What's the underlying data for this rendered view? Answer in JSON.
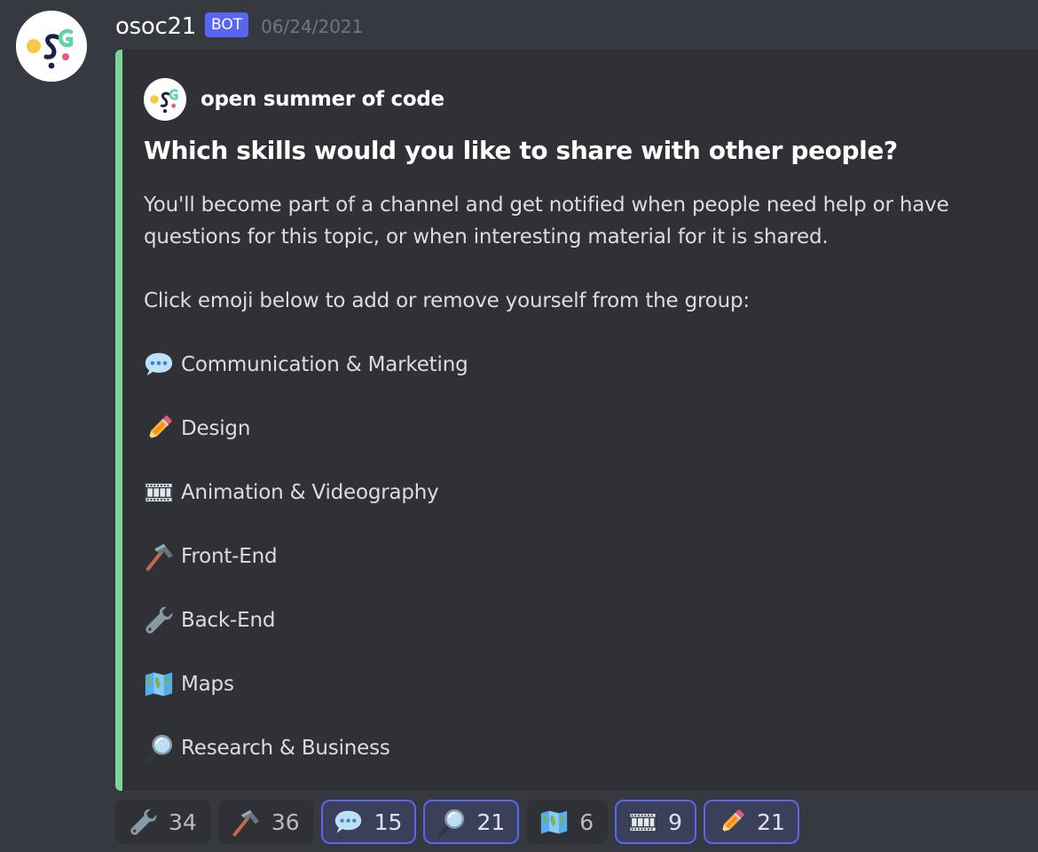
{
  "message": {
    "username": "osoc21",
    "bot_tag": "BOT",
    "timestamp": "06/24/2021",
    "avatar_icon": "osoc-logo-icon"
  },
  "embed": {
    "accent_color": "#7ed39a",
    "author_name": "open summer of code",
    "author_icon": "osoc-logo-icon",
    "title": "Which skills would you like to share with other people?",
    "description": "You'll become part of a channel and get notified when people need help or have questions for this topic, or when interesting material for it is shared.",
    "instruction": "Click emoji below to add or remove yourself from the group:",
    "skills": [
      {
        "icon": "speech-balloon-icon",
        "label": "Communication & Marketing"
      },
      {
        "icon": "pencil-icon",
        "label": "Design"
      },
      {
        "icon": "film-frames-icon",
        "label": "Animation & Videography"
      },
      {
        "icon": "hammer-icon",
        "label": "Front-End"
      },
      {
        "icon": "wrench-icon",
        "label": "Back-End"
      },
      {
        "icon": "world-map-icon",
        "label": "Maps"
      },
      {
        "icon": "magnifying-glass-icon",
        "label": "Research & Business"
      }
    ]
  },
  "reactions": [
    {
      "icon": "wrench-icon",
      "count": "34",
      "active": false
    },
    {
      "icon": "hammer-icon",
      "count": "36",
      "active": false
    },
    {
      "icon": "speech-balloon-icon",
      "count": "15",
      "active": true
    },
    {
      "icon": "magnifying-glass-icon",
      "count": "21",
      "active": true
    },
    {
      "icon": "world-map-icon",
      "count": "6",
      "active": false
    },
    {
      "icon": "film-frames-icon",
      "count": "9",
      "active": true
    },
    {
      "icon": "pencil-icon",
      "count": "21",
      "active": true
    }
  ],
  "colors": {
    "background": "#36393f",
    "embed_background": "#2f3136",
    "bot_tag": "#5865f2",
    "reaction_active_border": "#5865f2"
  }
}
